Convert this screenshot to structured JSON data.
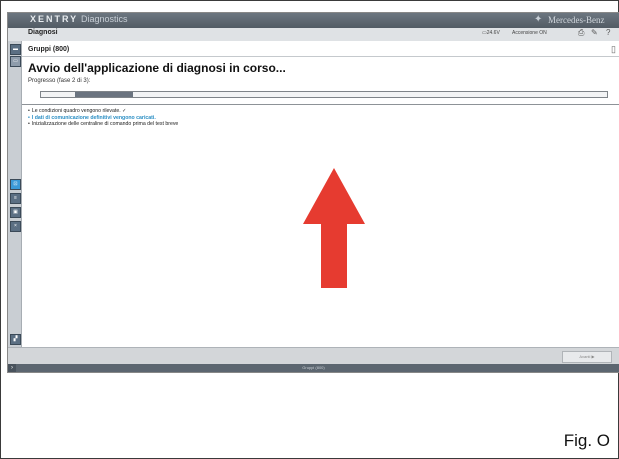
{
  "window": {
    "brand_bold": "XENTRY",
    "brand_light": "Diagnostics",
    "vendor_star": "✦",
    "vendor": "Mercedes-Benz"
  },
  "menubar": {
    "title": "Diagnosi",
    "voltage": "24.6V",
    "connection": "Accensione ON"
  },
  "content": {
    "group_label": "Gruppi (800)",
    "heading": "Avvio dell'applicazione di diagnosi in corso...",
    "progress_label": "Progresso (fase 2 di 3):",
    "progress": {
      "phase": 2,
      "total": 3
    },
    "steps": [
      {
        "text": "Le condizioni quadro vengono rilevate. ✓",
        "active": false
      },
      {
        "text": "I dati di comunicazione definitivi vengono caricati.",
        "active": true
      },
      {
        "text": "Inizializzazione delle centraline di comando prima del test breve",
        "active": false
      }
    ]
  },
  "bottombar": {
    "next_label": "Avanti ▶"
  },
  "footer": {
    "text": "Gruppi (800)"
  },
  "caption": "Fig. O",
  "colors": {
    "arrow": "#e63b30",
    "active_step": "#2a8ec4",
    "titlebar": "#5e6871"
  }
}
